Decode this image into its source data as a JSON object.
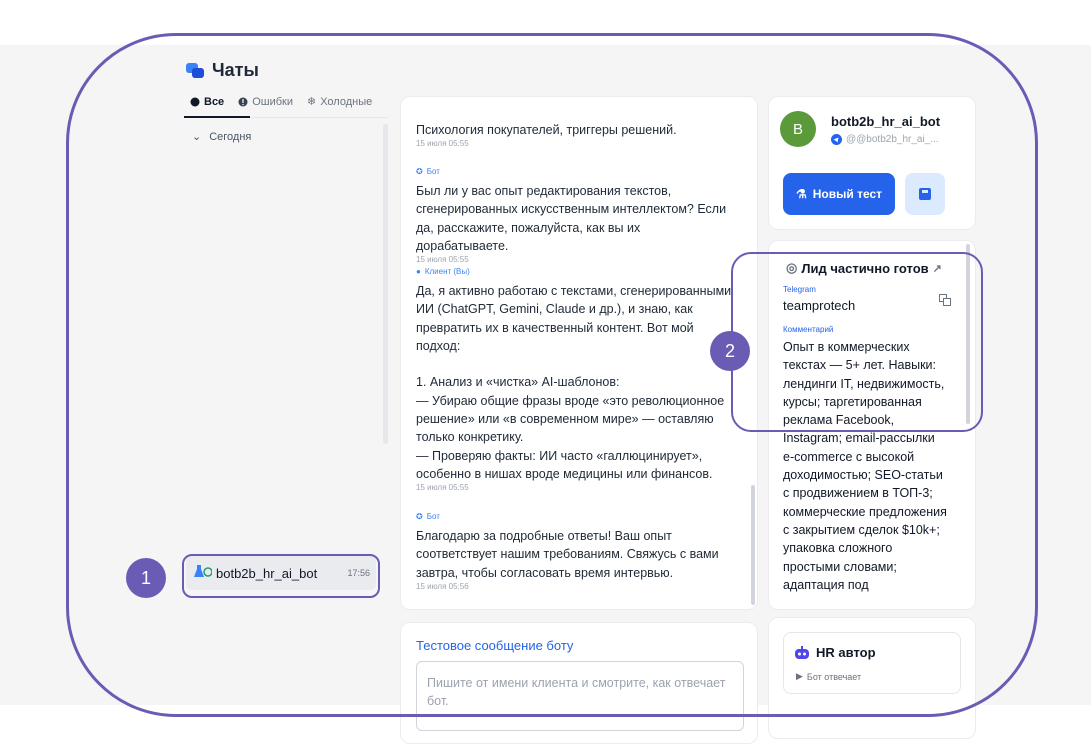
{
  "header": {
    "title": "Чаты"
  },
  "tabs": [
    {
      "label": "Все"
    },
    {
      "label": "Ошибки"
    },
    {
      "label": "Холодные"
    }
  ],
  "group": {
    "label": "Сегодня"
  },
  "chat_list": [
    {
      "name": "botb2b_hr_ai_bot",
      "time": "17:56"
    }
  ],
  "messages": [
    {
      "text": "Психология покупателей, триггеры решений.",
      "time": "15 июля 05:55"
    },
    {
      "role": "Бот",
      "text": "Был ли у вас опыт редактирования текстов, сгенерированных искусственным интеллектом? Если да, расскажите, пожалуйста, как вы их дорабатываете.",
      "time": "15 июля 05:55"
    },
    {
      "role": "Клиент (Вы)",
      "text": "Да, я активно работаю с текстами, сгенерированными ИИ (ChatGPT, Gemini, Claude и др.), и знаю, как превратить их в качественный контент. Вот мой подход:\n\n1. Анализ и «чистка» AI-шаблонов:\n— Убираю общие фразы вроде «это революционное решение» или «в современном мире» — оставляю только конкретику.\n— Проверяю факты: ИИ часто «галлюцинирует», особенно в нишах вроде медицины или финансов.",
      "time": "15 июля 05:55"
    },
    {
      "role": "Бот",
      "text": "Благодарю за подробные ответы! Ваш опыт соответствует нашим требованиям. Свяжусь с вами завтра, чтобы согласовать время интервью.",
      "time": "15 июля 05:56"
    }
  ],
  "test_message": {
    "title": "Тестовое сообщение боту",
    "placeholder": "Пишите от имени клиента и смотрите, как отвечает бот."
  },
  "bot": {
    "avatar_letter": "B",
    "name": "botb2b_hr_ai_bot",
    "handle": "@@botb2b_hr_ai_...",
    "new_test_label": "Новый тест"
  },
  "lead": {
    "title": "Лид частично готов",
    "telegram_label": "Telegram",
    "telegram_value": "teamprotech",
    "comment_label": "Комментарий",
    "comment": "Опыт в коммерческих текстах — 5+ лет. Навыки: лендинги IT, недвижимость, курсы; таргетированная реклама Facebook, Instagram; email-рассылки e-commerce с высокой доходимостью; SEO-статьи с продвижением в ТОП-3; коммерческие предложения с закрытием сделок $10k+; упаковка сложного простыми словами; адаптация под"
  },
  "hr": {
    "title": "HR автор",
    "status": "Бот отвечает"
  },
  "annotations": [
    "1",
    "2"
  ],
  "colors": {
    "accent": "#6a5bb5",
    "primary": "#2563eb",
    "avatar": "#5a9a3a"
  }
}
